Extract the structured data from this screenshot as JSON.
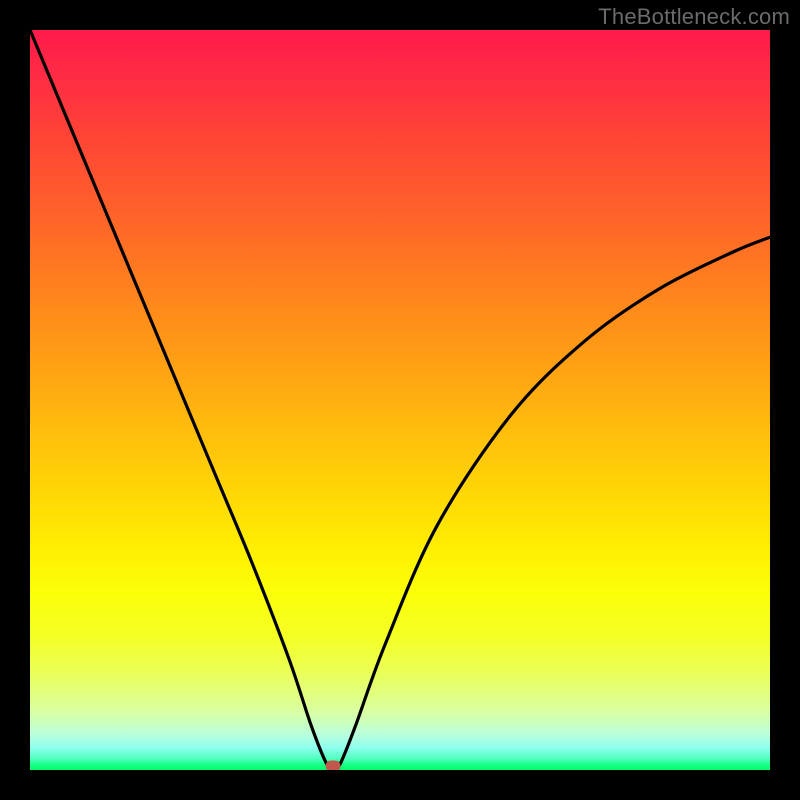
{
  "watermark": "TheBottleneck.com",
  "chart_data": {
    "type": "line",
    "title": "",
    "xlabel": "",
    "ylabel": "",
    "xlim": [
      0,
      100
    ],
    "ylim": [
      0,
      100
    ],
    "gradient": {
      "direction": "vertical",
      "top_color": "#ff1a4a",
      "mid_color": "#ffee02",
      "bottom_color": "#00ff66",
      "meaning": "top=high bottleneck, bottom=low bottleneck"
    },
    "series": [
      {
        "name": "bottleneck-curve",
        "x": [
          0,
          5,
          10,
          15,
          20,
          25,
          30,
          35,
          38,
          40,
          41,
          42,
          44,
          48,
          55,
          65,
          75,
          85,
          95,
          100
        ],
        "values": [
          100,
          88,
          76,
          64,
          52,
          40,
          28,
          15,
          6,
          1,
          0,
          1,
          6,
          17,
          33,
          48,
          58,
          65,
          70,
          72
        ]
      }
    ],
    "marker": {
      "x": 41,
      "y": 0.5,
      "name": "optimal-point"
    },
    "annotations": []
  }
}
